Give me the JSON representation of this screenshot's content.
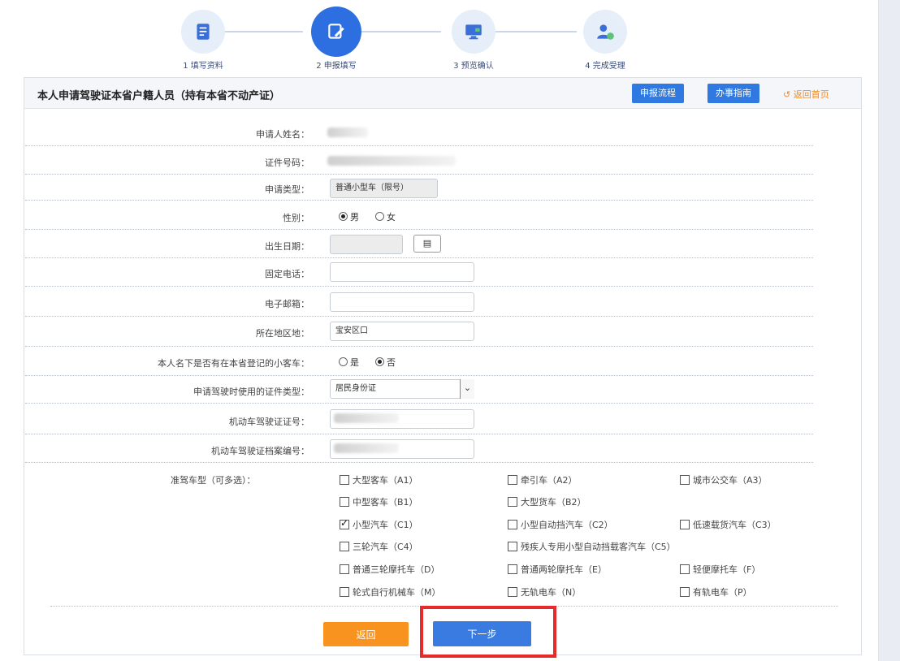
{
  "steps": [
    {
      "label": "1 填写资料",
      "icon": "form-icon"
    },
    {
      "label": "2 申报填写",
      "icon": "edit-icon"
    },
    {
      "label": "3 预览确认",
      "icon": "monitor-icon"
    },
    {
      "label": "4 完成受理",
      "icon": "user-check-icon"
    }
  ],
  "panel": {
    "title": "本人申请驾驶证本省户籍人员（持有本省不动产证）",
    "btn_process": "申报流程",
    "btn_guide": "办事指南",
    "back_link": "返回首页"
  },
  "form": {
    "name_label": "申请人姓名：",
    "id_label": "证件号码：",
    "type_label": "申请类型：",
    "type_value": "普通小型车（限号）",
    "gender_label": "性别：",
    "gender_male": "男",
    "gender_female": "女",
    "birth_label": "出生日期：",
    "phone_label": "固定电话：",
    "email_label": "电子邮箱：",
    "addr_label": "所在地区地：",
    "addr_value": "宝安区口",
    "has_car_label": "本人名下是否有在本省登记的小客车：",
    "yes": "是",
    "no": "否",
    "doc_type_label": "申请驾驶时使用的证件类型：",
    "doc_type_value": "居民身份证",
    "license_no_label": "机动车驾驶证证号：",
    "archive_no_label": "机动车驾驶证档案编号：",
    "vehicle_label": "准驾车型（可多选）："
  },
  "vehicles": [
    {
      "label": "大型客车（A1）",
      "checked": false
    },
    {
      "label": "牵引车（A2）",
      "checked": false
    },
    {
      "label": "城市公交车（A3）",
      "checked": false
    },
    {
      "label": "中型客车（B1）",
      "checked": false
    },
    {
      "label": "大型货车（B2）",
      "checked": false
    },
    {
      "label": "小型汽车（C1）",
      "checked": true
    },
    {
      "label": "小型自动挡汽车（C2）",
      "checked": false
    },
    {
      "label": "低速载货汽车（C3）",
      "checked": false
    },
    {
      "label": "三轮汽车（C4）",
      "checked": false
    },
    {
      "label": "残疾人专用小型自动挡载客汽车（C5）",
      "checked": false
    },
    {
      "label": "普通三轮摩托车（D）",
      "checked": false
    },
    {
      "label": "普通两轮摩托车（E）",
      "checked": false
    },
    {
      "label": "轻便摩托车（F）",
      "checked": false
    },
    {
      "label": "轮式自行机械车（M）",
      "checked": false
    },
    {
      "label": "无轨电车（N）",
      "checked": false
    },
    {
      "label": "有轨电车（P）",
      "checked": false
    }
  ],
  "actions": {
    "back": "返回",
    "next": "下一步"
  },
  "colors": {
    "primary": "#2f79e0",
    "orange": "#f7931e",
    "highlight": "#e52b2b"
  }
}
